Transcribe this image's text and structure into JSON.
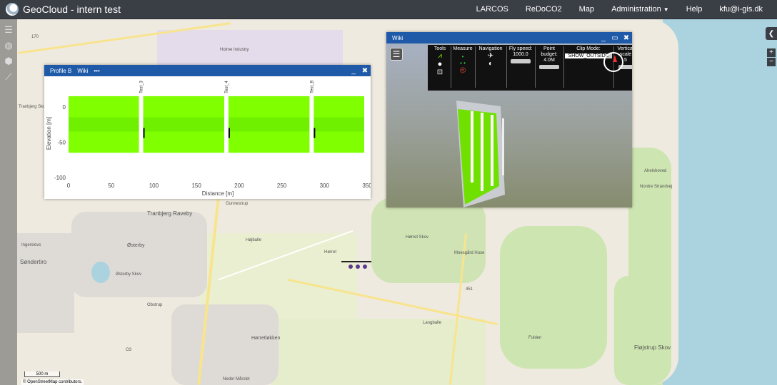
{
  "app": {
    "title": "GeoCloud - intern test"
  },
  "nav": {
    "items": [
      "LARCOS",
      "ReDoCO2",
      "Map",
      "Administration",
      "Help",
      "kfu@i-gis.dk"
    ]
  },
  "map": {
    "labels": [
      "Holme Industry",
      "Tranbjerg Skov",
      "Tranbjerg Raveby",
      "Søndertiro",
      "Østerby",
      "Østerby Skov",
      "Gunnestrup",
      "Højballe",
      "Hørret",
      "Hørret Skov",
      "Moesgård Huse",
      "Hørretløkken",
      "Langballe",
      "Fulden",
      "Fløjstrup Skov",
      "Ahelshoved",
      "Nordre Strandvej",
      "Ingerslevs",
      "Obstrup",
      "Neder Mårslet",
      "O3",
      "451",
      "170"
    ],
    "attribution": "© OpenStreetMap contributors.",
    "scale": "500 m"
  },
  "profile": {
    "title": "Profile B",
    "tab": "Wiki",
    "more": "•••",
    "chart_data": {
      "type": "area",
      "title": "",
      "xlabel": "Distance [m]",
      "ylabel": "Elevation [m]",
      "xlim": [
        0,
        350
      ],
      "ylim": [
        -100,
        25
      ],
      "xticks": [
        0,
        50,
        100,
        150,
        200,
        250,
        300,
        350
      ],
      "yticks": [
        0,
        -50,
        -100
      ],
      "wells": [
        {
          "name": "Test_3",
          "x": 85
        },
        {
          "name": "Test_4",
          "x": 185
        },
        {
          "name": "Test_B",
          "x": 285
        }
      ],
      "surface_top": 15,
      "surface_bottom": -65
    }
  },
  "wiki": {
    "title": "Wiki",
    "tools": {
      "tools_label": "Tools",
      "measure_label": "Measure",
      "navigation_label": "Navigation",
      "fly_speed_label": "Fly speed:",
      "fly_speed_value": "1000.0",
      "point_budget_label": "Point budget:",
      "point_budget_value": "4.0M",
      "clip_mode_label": "Clip Mode:",
      "clip_mode_value": "SHOW_OUTSIDE",
      "vertical_label": "Vertical",
      "scale_label": "scale",
      "scale_value": "5"
    }
  },
  "colors": {
    "accent": "#1e5aa8",
    "topbar": "#3a3e45",
    "green": "#7fff00"
  }
}
